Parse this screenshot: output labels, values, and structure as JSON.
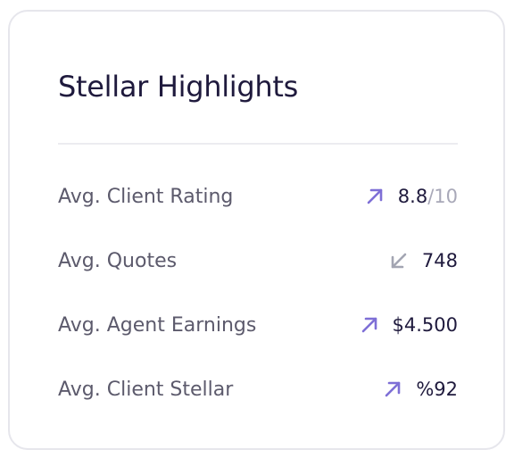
{
  "card": {
    "title": "Stellar Highlights"
  },
  "colors": {
    "up": "#7e6fd6",
    "down": "#a3a5b2",
    "text_dark": "#1f1a3d",
    "text_label": "#5c5a6c",
    "suffix": "#a8a8b8"
  },
  "stats": [
    {
      "label": "Avg. Client Rating",
      "trend": "arrow-up-right-icon",
      "value": "8.8",
      "suffix": "/10"
    },
    {
      "label": "Avg. Quotes",
      "trend": "arrow-down-left-icon",
      "value": "748",
      "suffix": ""
    },
    {
      "label": "Avg. Agent Earnings",
      "trend": "arrow-up-right-icon",
      "value": "$4.500",
      "suffix": ""
    },
    {
      "label": "Avg. Client Stellar",
      "trend": "arrow-up-right-icon",
      "value": "%92",
      "suffix": ""
    }
  ]
}
